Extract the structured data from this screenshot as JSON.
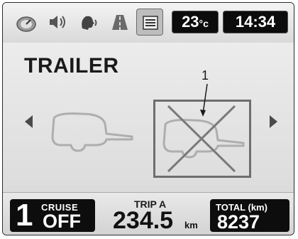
{
  "header": {
    "icons": [
      "speedometer-icon",
      "speaker-icon",
      "voice-icon",
      "road-icon",
      "menu-list-icon"
    ],
    "active_icon": "menu-list-icon",
    "temperature": "23",
    "temperature_unit": "°c",
    "time": "14:34"
  },
  "main": {
    "title": "TRAILER",
    "left_arrow": "‹",
    "right_arrow": "›",
    "callout_number": "1"
  },
  "footer": {
    "gear": "1",
    "cruise_label": "CRUISE",
    "cruise_value": "OFF",
    "trip_label": "TRIP A",
    "trip_value": "234.5",
    "trip_unit": "km",
    "total_label": "TOTAL (km)",
    "total_value": "8237"
  },
  "colors": {
    "pill_bg": "#0c0c0c",
    "panel_bg": "#e8e8e8",
    "trailer_stroke": "#b0b0b0",
    "cross_stroke": "#7a7a7a"
  }
}
